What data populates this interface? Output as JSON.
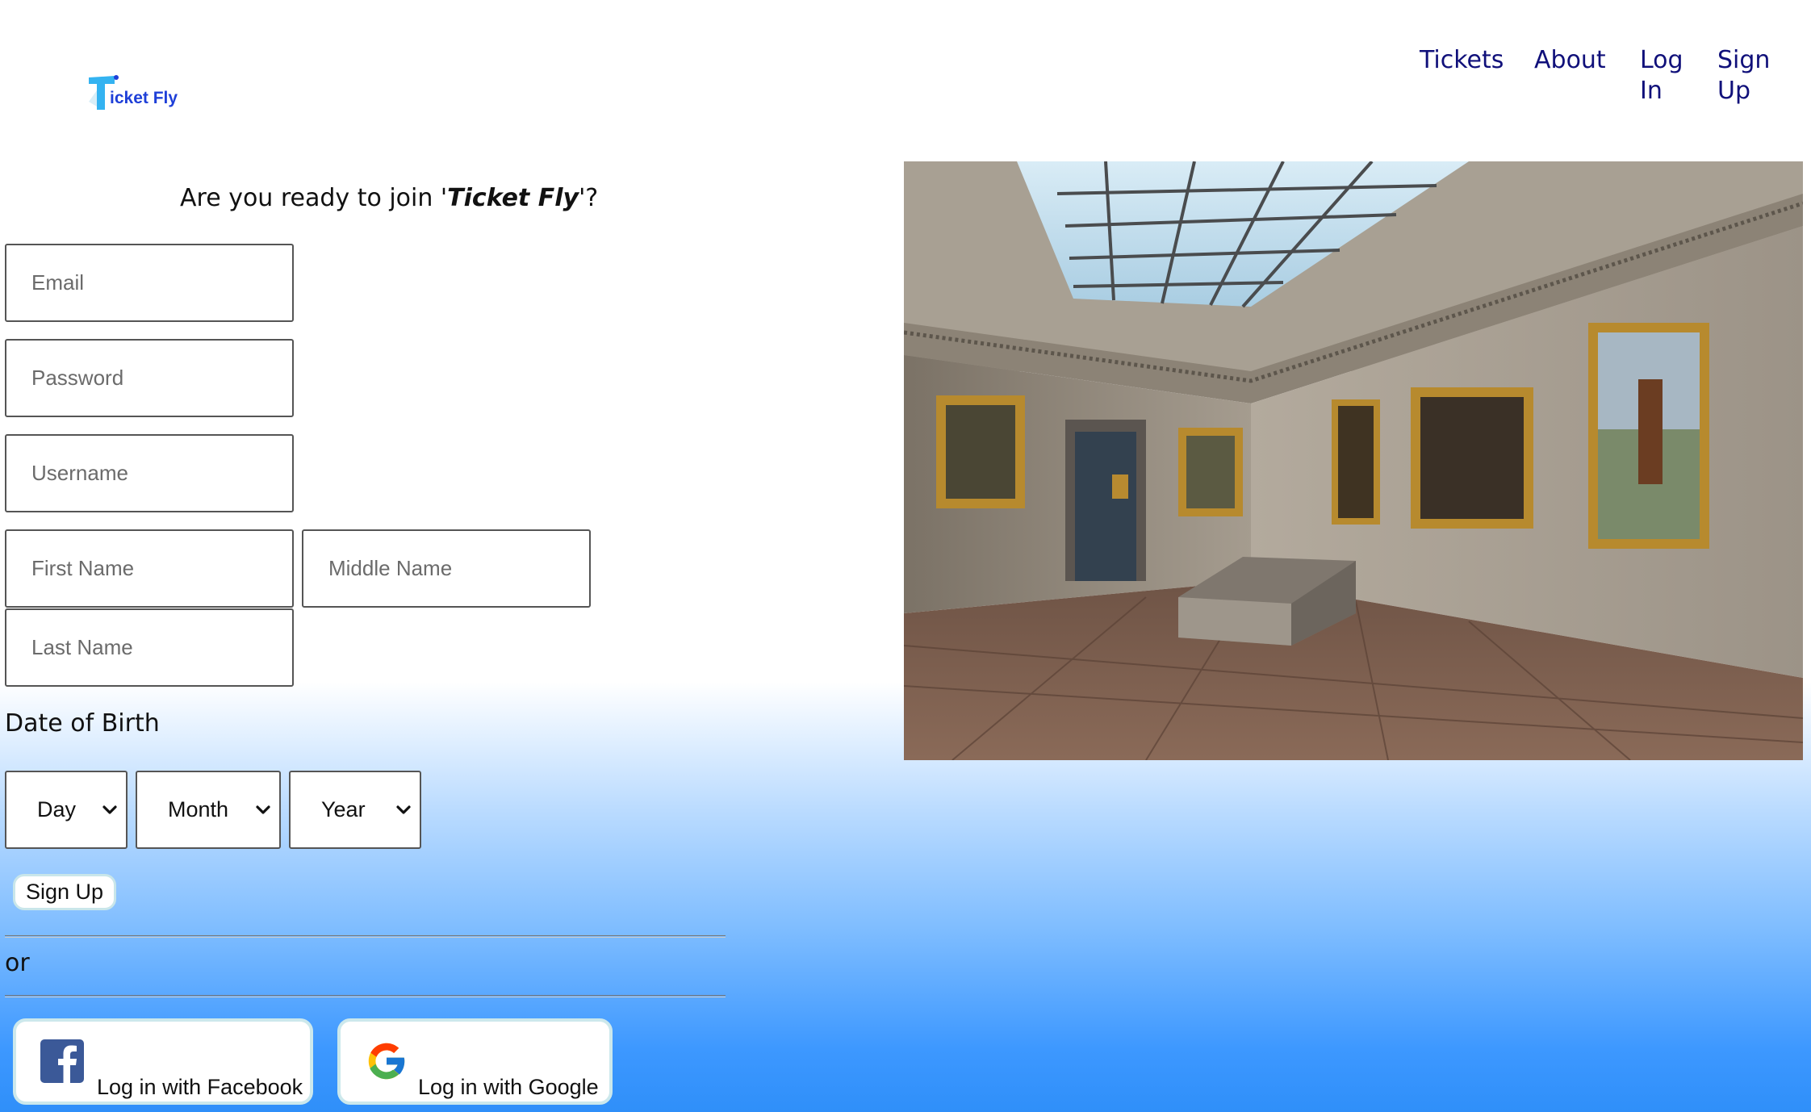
{
  "header": {
    "logo_text": "icket Fly",
    "nav": [
      "Tickets",
      "About",
      "Log In",
      "Sign Up"
    ]
  },
  "form": {
    "heading_prefix": "Are you ready to join '",
    "heading_brand": "Ticket Fly",
    "heading_suffix": "'?",
    "placeholders": {
      "email": "Email",
      "password": "Password",
      "username": "Username",
      "first_name": "First Name",
      "middle_name": "Middle Name",
      "last_name": "Last Name"
    },
    "dob_label": "Date of Birth",
    "dob_selects": [
      "Day",
      "Month",
      "Year"
    ],
    "signup_label": "Sign Up",
    "or_text": "or",
    "facebook_label": "Log in with Facebook",
    "google_label": "Log in with Google"
  },
  "colors": {
    "nav_link": "#10107a",
    "logo_text": "#1e3fd8",
    "facebook_blue": "#3b5998",
    "gradient_bottom": "#2f8ff9"
  }
}
